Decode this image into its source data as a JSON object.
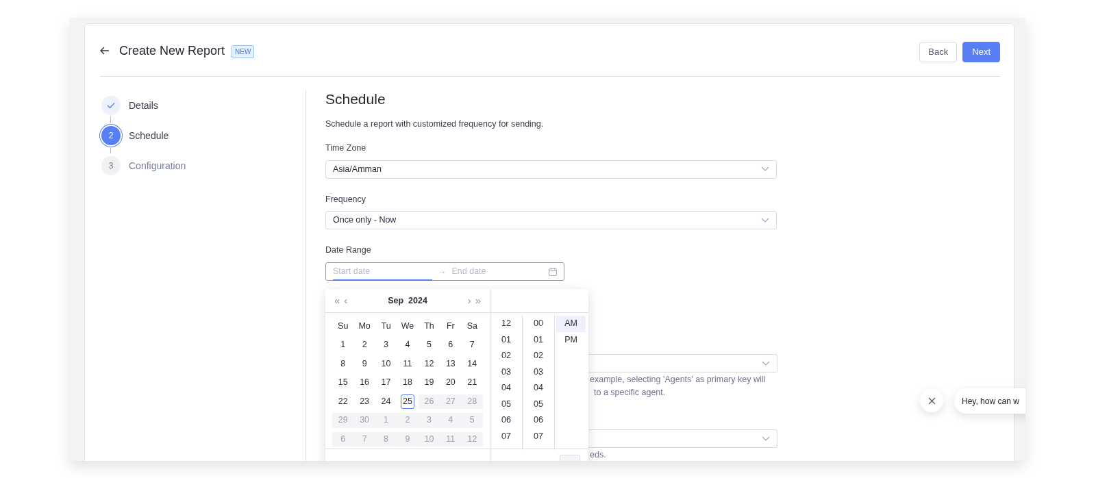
{
  "header": {
    "title": "Create New Report",
    "badge": "NEW",
    "buttons": [
      {
        "label": "Back",
        "kind": "secondary"
      },
      {
        "label": "Next",
        "kind": "primary"
      }
    ]
  },
  "steps": [
    {
      "label": "Details",
      "done": true,
      "selected": false
    },
    {
      "label": "Schedule",
      "number": "2",
      "done": false,
      "selected": true
    },
    {
      "label": "Configuration",
      "number": "3",
      "done": false,
      "selected": false
    }
  ],
  "section": {
    "title": "Schedule",
    "description": "Schedule a report with customized frequency for sending."
  },
  "fields": [
    {
      "label": "Time Zone",
      "value": "Asia/Amman"
    },
    {
      "label": "Frequency",
      "value": "Once only - Now"
    }
  ],
  "date_range": {
    "label": "Date Range",
    "start_placeholder": "Start date",
    "end_placeholder": "End date",
    "separator": "→"
  },
  "picker": {
    "month": "Sep",
    "year": "2024",
    "nav": [
      "«",
      "‹",
      "›",
      "»"
    ],
    "weekdays": [
      "Su",
      "Mo",
      "Tu",
      "We",
      "Th",
      "Fr",
      "Sa"
    ],
    "weeks": [
      [
        {
          "day": "1",
          "disabled": false,
          "today": false
        },
        {
          "day": "2",
          "disabled": false,
          "today": false
        },
        {
          "day": "3",
          "disabled": false,
          "today": false
        },
        {
          "day": "4",
          "disabled": false,
          "today": false
        },
        {
          "day": "5",
          "disabled": false,
          "today": false
        },
        {
          "day": "6",
          "disabled": false,
          "today": false
        },
        {
          "day": "7",
          "disabled": false,
          "today": false
        }
      ],
      [
        {
          "day": "8",
          "disabled": false,
          "today": false
        },
        {
          "day": "9",
          "disabled": false,
          "today": false
        },
        {
          "day": "10",
          "disabled": false,
          "today": false
        },
        {
          "day": "11",
          "disabled": false,
          "today": false
        },
        {
          "day": "12",
          "disabled": false,
          "today": false
        },
        {
          "day": "13",
          "disabled": false,
          "today": false
        },
        {
          "day": "14",
          "disabled": false,
          "today": false
        }
      ],
      [
        {
          "day": "15",
          "disabled": false,
          "today": false
        },
        {
          "day": "16",
          "disabled": false,
          "today": false
        },
        {
          "day": "17",
          "disabled": false,
          "today": false
        },
        {
          "day": "18",
          "disabled": false,
          "today": false
        },
        {
          "day": "19",
          "disabled": false,
          "today": false
        },
        {
          "day": "20",
          "disabled": false,
          "today": false
        },
        {
          "day": "21",
          "disabled": false,
          "today": false
        }
      ],
      [
        {
          "day": "22",
          "disabled": false,
          "today": false
        },
        {
          "day": "23",
          "disabled": false,
          "today": false
        },
        {
          "day": "24",
          "disabled": false,
          "today": false
        },
        {
          "day": "25",
          "disabled": false,
          "today": true
        },
        {
          "day": "26",
          "disabled": true,
          "today": false
        },
        {
          "day": "27",
          "disabled": true,
          "today": false
        },
        {
          "day": "28",
          "disabled": true,
          "today": false
        }
      ],
      [
        {
          "day": "29",
          "disabled": true,
          "today": false
        },
        {
          "day": "30",
          "disabled": true,
          "today": false
        },
        {
          "day": "1",
          "disabled": true,
          "today": false
        },
        {
          "day": "2",
          "disabled": true,
          "today": false
        },
        {
          "day": "3",
          "disabled": true,
          "today": false
        },
        {
          "day": "4",
          "disabled": true,
          "today": false
        },
        {
          "day": "5",
          "disabled": true,
          "today": false
        }
      ],
      [
        {
          "day": "6",
          "disabled": true,
          "today": false
        },
        {
          "day": "7",
          "disabled": true,
          "today": false
        },
        {
          "day": "8",
          "disabled": true,
          "today": false
        },
        {
          "day": "9",
          "disabled": true,
          "today": false
        },
        {
          "day": "10",
          "disabled": true,
          "today": false
        },
        {
          "day": "11",
          "disabled": true,
          "today": false
        },
        {
          "day": "12",
          "disabled": true,
          "today": false
        }
      ]
    ],
    "hours": [
      "12",
      "01",
      "02",
      "03",
      "04",
      "05",
      "06",
      "07"
    ],
    "minutes": [
      "00",
      "01",
      "02",
      "03",
      "04",
      "05",
      "06",
      "07"
    ],
    "periods": [
      {
        "label": "AM",
        "selected": true
      },
      {
        "label": "PM",
        "selected": false
      }
    ]
  },
  "covered_fields": [
    {
      "helper_lines": [
        "example, selecting 'Agents' as primary key will",
        "to a specific agent."
      ]
    },
    {
      "helper_lines": [
        "eds."
      ]
    }
  ],
  "chat": {
    "message": "Hey, how can w"
  }
}
